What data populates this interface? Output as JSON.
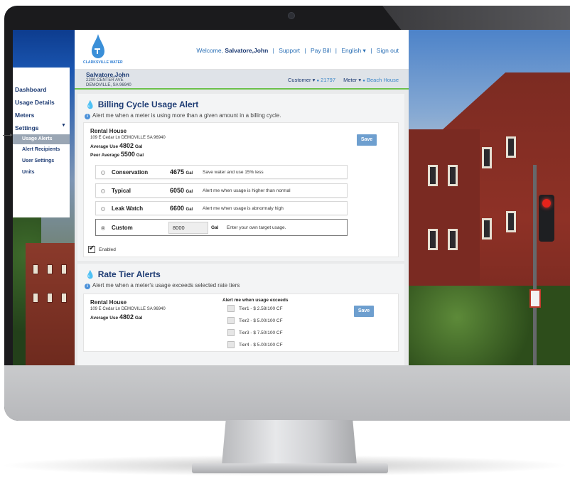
{
  "header": {
    "logo_text": "CLARKSVILLE WATER",
    "welcome": "Welcome,",
    "user": "Salvatore,John",
    "nav": [
      "Support",
      "Pay Bill",
      "English ▾",
      "Sign out"
    ]
  },
  "account": {
    "name": "Salvatore,John",
    "addr1": "2200 CENTER AVE",
    "addr2": "DEMOVILLE, SA 96940",
    "customer_label": "Customer ▾",
    "customer_value": "21797",
    "meter_label": "Meter ▾",
    "meter_value": "Beach House"
  },
  "sidebar": {
    "items": [
      "Dashboard",
      "Usage Details",
      "Meters",
      "Settings"
    ],
    "settings_arrow": "▼",
    "subitems": [
      "Usage Alerts",
      "Alert Recipients",
      "User Settings",
      "Units"
    ]
  },
  "billing": {
    "title": "Billing Cycle Usage Alert",
    "subtitle": "Alert me when a meter is using more than a given amount in a billing cycle.",
    "site_name": "Rental House",
    "site_addr": "109 E Cedar Ln DEMOVILLE SA 96940",
    "avg_label": "Average Use",
    "avg_value": "4802",
    "avg_unit": "Gal",
    "peer_label": "Peer Average",
    "peer_value": "5500",
    "peer_unit": "Gal",
    "save": "Save",
    "options": [
      {
        "name": "Conservation",
        "gal": "4675",
        "unit": "Gal",
        "desc": "Save water and use 15% less"
      },
      {
        "name": "Typical",
        "gal": "6050",
        "unit": "Gal",
        "desc": "Alert me when usage is higher than normal"
      },
      {
        "name": "Leak Watch",
        "gal": "6600",
        "unit": "Gal",
        "desc": "Alert me when usage is abnormaly high"
      }
    ],
    "custom": {
      "name": "Custom",
      "value": "8000",
      "unit": "Gal",
      "desc": "Enter your own target usage."
    },
    "enabled": "Enabled"
  },
  "rate": {
    "title": "Rate Tier Alerts",
    "subtitle": "Alert me when a meter's usage exceeds selected rate tiers",
    "site_name": "Rental House",
    "site_addr": "109 E Cedar Ln DEMOVILLE SA 96940",
    "avg_label": "Average Use",
    "avg_value": "4802",
    "avg_unit": "Gal",
    "tier_header": "Alert me when usage exceeds",
    "tiers": [
      "Tier1 - $ 2.58/100 CF",
      "Tier2 - $ 5.00/100 CF",
      "Tier3 - $ 7.50/100 CF",
      "Tier4 - $ 5.00/100 CF"
    ],
    "save": "Save"
  }
}
